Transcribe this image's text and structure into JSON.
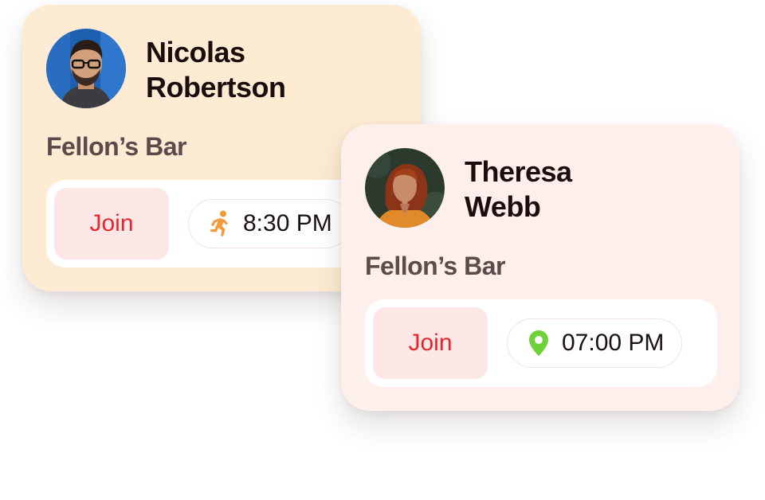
{
  "cards": [
    {
      "name_line1": "Nicolas",
      "name_line2": "Robertson",
      "venue": "Fellon’s Bar",
      "join_label": "Join",
      "time": "8:30 PM",
      "status_icon": "running-person-icon",
      "background": "#fdebd3"
    },
    {
      "name_line1": "Theresa",
      "name_line2": "Webb",
      "venue": "Fellon’s Bar",
      "join_label": "Join",
      "time": "07:00 PM",
      "status_icon": "location-pin-icon",
      "background": "#fdf0ec"
    }
  ],
  "colors": {
    "join_text": "#e8262e",
    "join_bg": "#fde7e6",
    "running_icon": "#f29a3a",
    "pin_icon": "#6fd13a"
  }
}
